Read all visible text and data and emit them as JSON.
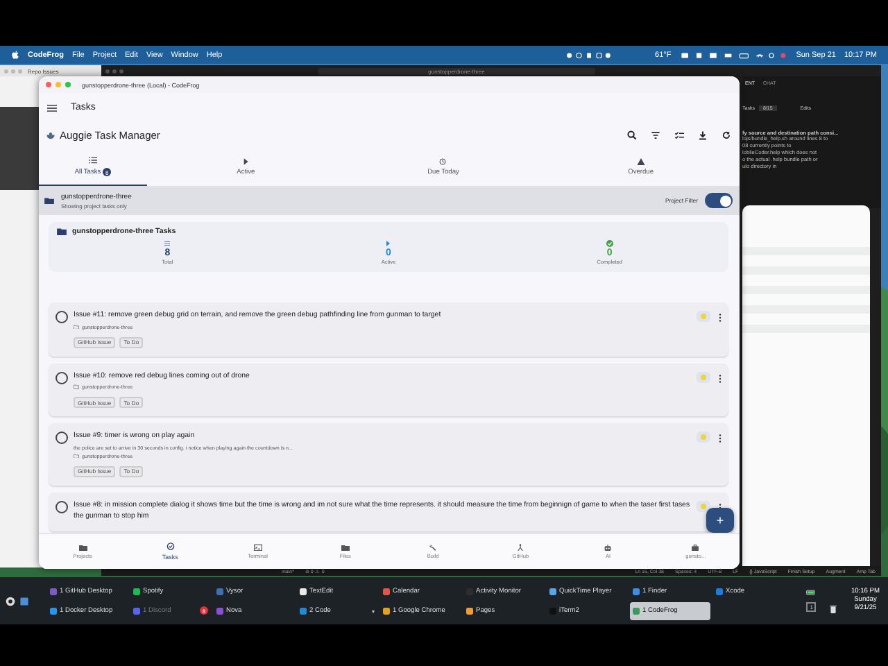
{
  "menubar": {
    "app": "CodeFrog",
    "menus": [
      "File",
      "Project",
      "Edit",
      "View",
      "Window",
      "Help"
    ],
    "weather": "61°F",
    "date": "Sun Sep 21",
    "time": "10:17 PM"
  },
  "browser": {
    "tab": "Repo Issues"
  },
  "editor": {
    "search": "gunstopperdrone-three",
    "panel_tabs": [
      {
        "label": "ENT",
        "selected": true
      },
      {
        "label": "CHAT",
        "selected": false
      }
    ],
    "tasks_label": "Tasks",
    "tasks_count": "8/15",
    "edits": "Edits",
    "heading": "fy source and destination path consi...",
    "lines": [
      "lojs/bundle_help.sh around lines 8 to",
      "08 currently points to",
      "lobileCoder.help which does not",
      "o the actual .help bundle path or",
      "ulo directory in"
    ],
    "status_left": [
      "main*",
      "⊘ 0 ⚠ 0"
    ],
    "status_right": [
      "Ln 16, Col 38",
      "Spaces: 4",
      "UTF-8",
      "LF",
      "{} JavaScript",
      "Finish Setup",
      "Augment",
      "Amp Tab"
    ]
  },
  "window": {
    "title": "gunstopperdrone-three (Local) - CodeFrog"
  },
  "header": {
    "title": "Tasks"
  },
  "manager": {
    "title": "Auggie Task Manager"
  },
  "tabs": [
    {
      "label": "All Tasks",
      "badge": "8",
      "kind": "list",
      "selected": true
    },
    {
      "label": "Active",
      "kind": "play",
      "selected": false
    },
    {
      "label": "Due Today",
      "kind": "clock",
      "selected": false
    },
    {
      "label": "Overdue",
      "kind": "warning",
      "selected": false
    }
  ],
  "project": {
    "name": "gunstopperdrone-three",
    "subtitle": "Showing project tasks only",
    "filter_label": "Project Filter",
    "filter_on": true
  },
  "summary": {
    "title": "gunstopperdrone-three Tasks",
    "stats": [
      {
        "kind": "total",
        "value": "8",
        "label": "Total"
      },
      {
        "kind": "active",
        "value": "0",
        "label": "Active"
      },
      {
        "kind": "completed",
        "value": "0",
        "label": "Completed"
      }
    ]
  },
  "tasks": [
    {
      "title": "Issue #11: remove green debug grid on terrain, and remove the green debug pathfinding line from gunman to target",
      "project": "gunstopperdrone-three",
      "tags": [
        "GitHub Issue",
        "To Do"
      ],
      "checked": false
    },
    {
      "title": "Issue #10: remove red debug lines coming out of drone",
      "project": "gunstopperdrone-three",
      "tags": [
        "GitHub Issue",
        "To Do"
      ],
      "checked": false
    },
    {
      "title": "Issue #9: timer is wrong on play again",
      "description": "the police are set to arrive in 30 seconds in config. i notice when playing again the countdown is n...",
      "project": "gunstopperdrone-three",
      "tags": [
        "GitHub Issue",
        "To Do"
      ],
      "checked": false
    },
    {
      "title": "Issue #8: in mission complete dialog it shows time but the time is wrong and im not sure what the time represents. it should measure the time from beginnign of game to when the taser first tases the gunman to stop him",
      "checked": false
    }
  ],
  "fab": "+",
  "nav": [
    {
      "label": "Projects",
      "kind": "projects",
      "selected": false
    },
    {
      "label": "Tasks",
      "kind": "tasks",
      "selected": true
    },
    {
      "label": "Terminal",
      "kind": "terminal",
      "selected": false
    },
    {
      "label": "Files",
      "kind": "files",
      "selected": false
    },
    {
      "label": "Build",
      "kind": "build",
      "selected": false
    },
    {
      "label": "GitHub",
      "kind": "github",
      "selected": false
    },
    {
      "label": "AI",
      "kind": "ai",
      "selected": false
    },
    {
      "label": "gunsto...",
      "kind": "briefcase",
      "selected": false
    }
  ],
  "taskbar": {
    "apps": [
      {
        "label": "1 GitHub Desktop",
        "color": "#7b5cc4",
        "selected": false,
        "dimmed": false
      },
      {
        "label": "1 Docker Desktop",
        "color": "#2496ed",
        "selected": false,
        "dimmed": false
      },
      {
        "label": "Spotify",
        "color": "#1db954",
        "selected": false,
        "dimmed": false
      },
      {
        "label": "1 Discord",
        "color": "#5865f2",
        "badge": "8",
        "selected": false,
        "dimmed": true
      },
      {
        "label": "Vysor",
        "color": "#3f6fb5",
        "selected": false,
        "dimmed": false
      },
      {
        "label": "Nova",
        "color": "#8a4fd8",
        "selected": false,
        "dimmed": false
      },
      {
        "label": "TextEdit",
        "color": "#e8e8e8",
        "selected": false,
        "dimmed": false
      },
      {
        "label": "2 Code",
        "color": "#1f8ad2",
        "menu": "▾",
        "selected": false,
        "dimmed": false
      },
      {
        "label": "Calendar",
        "color": "#e5534b",
        "selected": false,
        "dimmed": false
      },
      {
        "label": "1 Google Chrome",
        "color": "#e3a21a",
        "selected": false,
        "dimmed": false
      },
      {
        "label": "Activity Monitor",
        "color": "#2d2d2d",
        "selected": false,
        "dimmed": false
      },
      {
        "label": "Pages",
        "color": "#f29a38",
        "selected": false,
        "dimmed": false
      },
      {
        "label": "QuickTime Player",
        "color": "#5aa3e6",
        "selected": false,
        "dimmed": false
      },
      {
        "label": "iTerm2",
        "color": "#111111",
        "selected": false,
        "dimmed": false
      },
      {
        "label": "1 Finder",
        "color": "#3a8ee6",
        "selected": false,
        "dimmed": false
      },
      {
        "label": "1 CodeFrog",
        "color": "#3c9a5f",
        "selected": true,
        "dimmed": false
      },
      {
        "label": "Xcode",
        "color": "#1c7ce0",
        "selected": false,
        "dimmed": false
      }
    ],
    "tray_count": "1",
    "clock": [
      "10:16 PM",
      "Sunday",
      "9/21/25"
    ]
  }
}
